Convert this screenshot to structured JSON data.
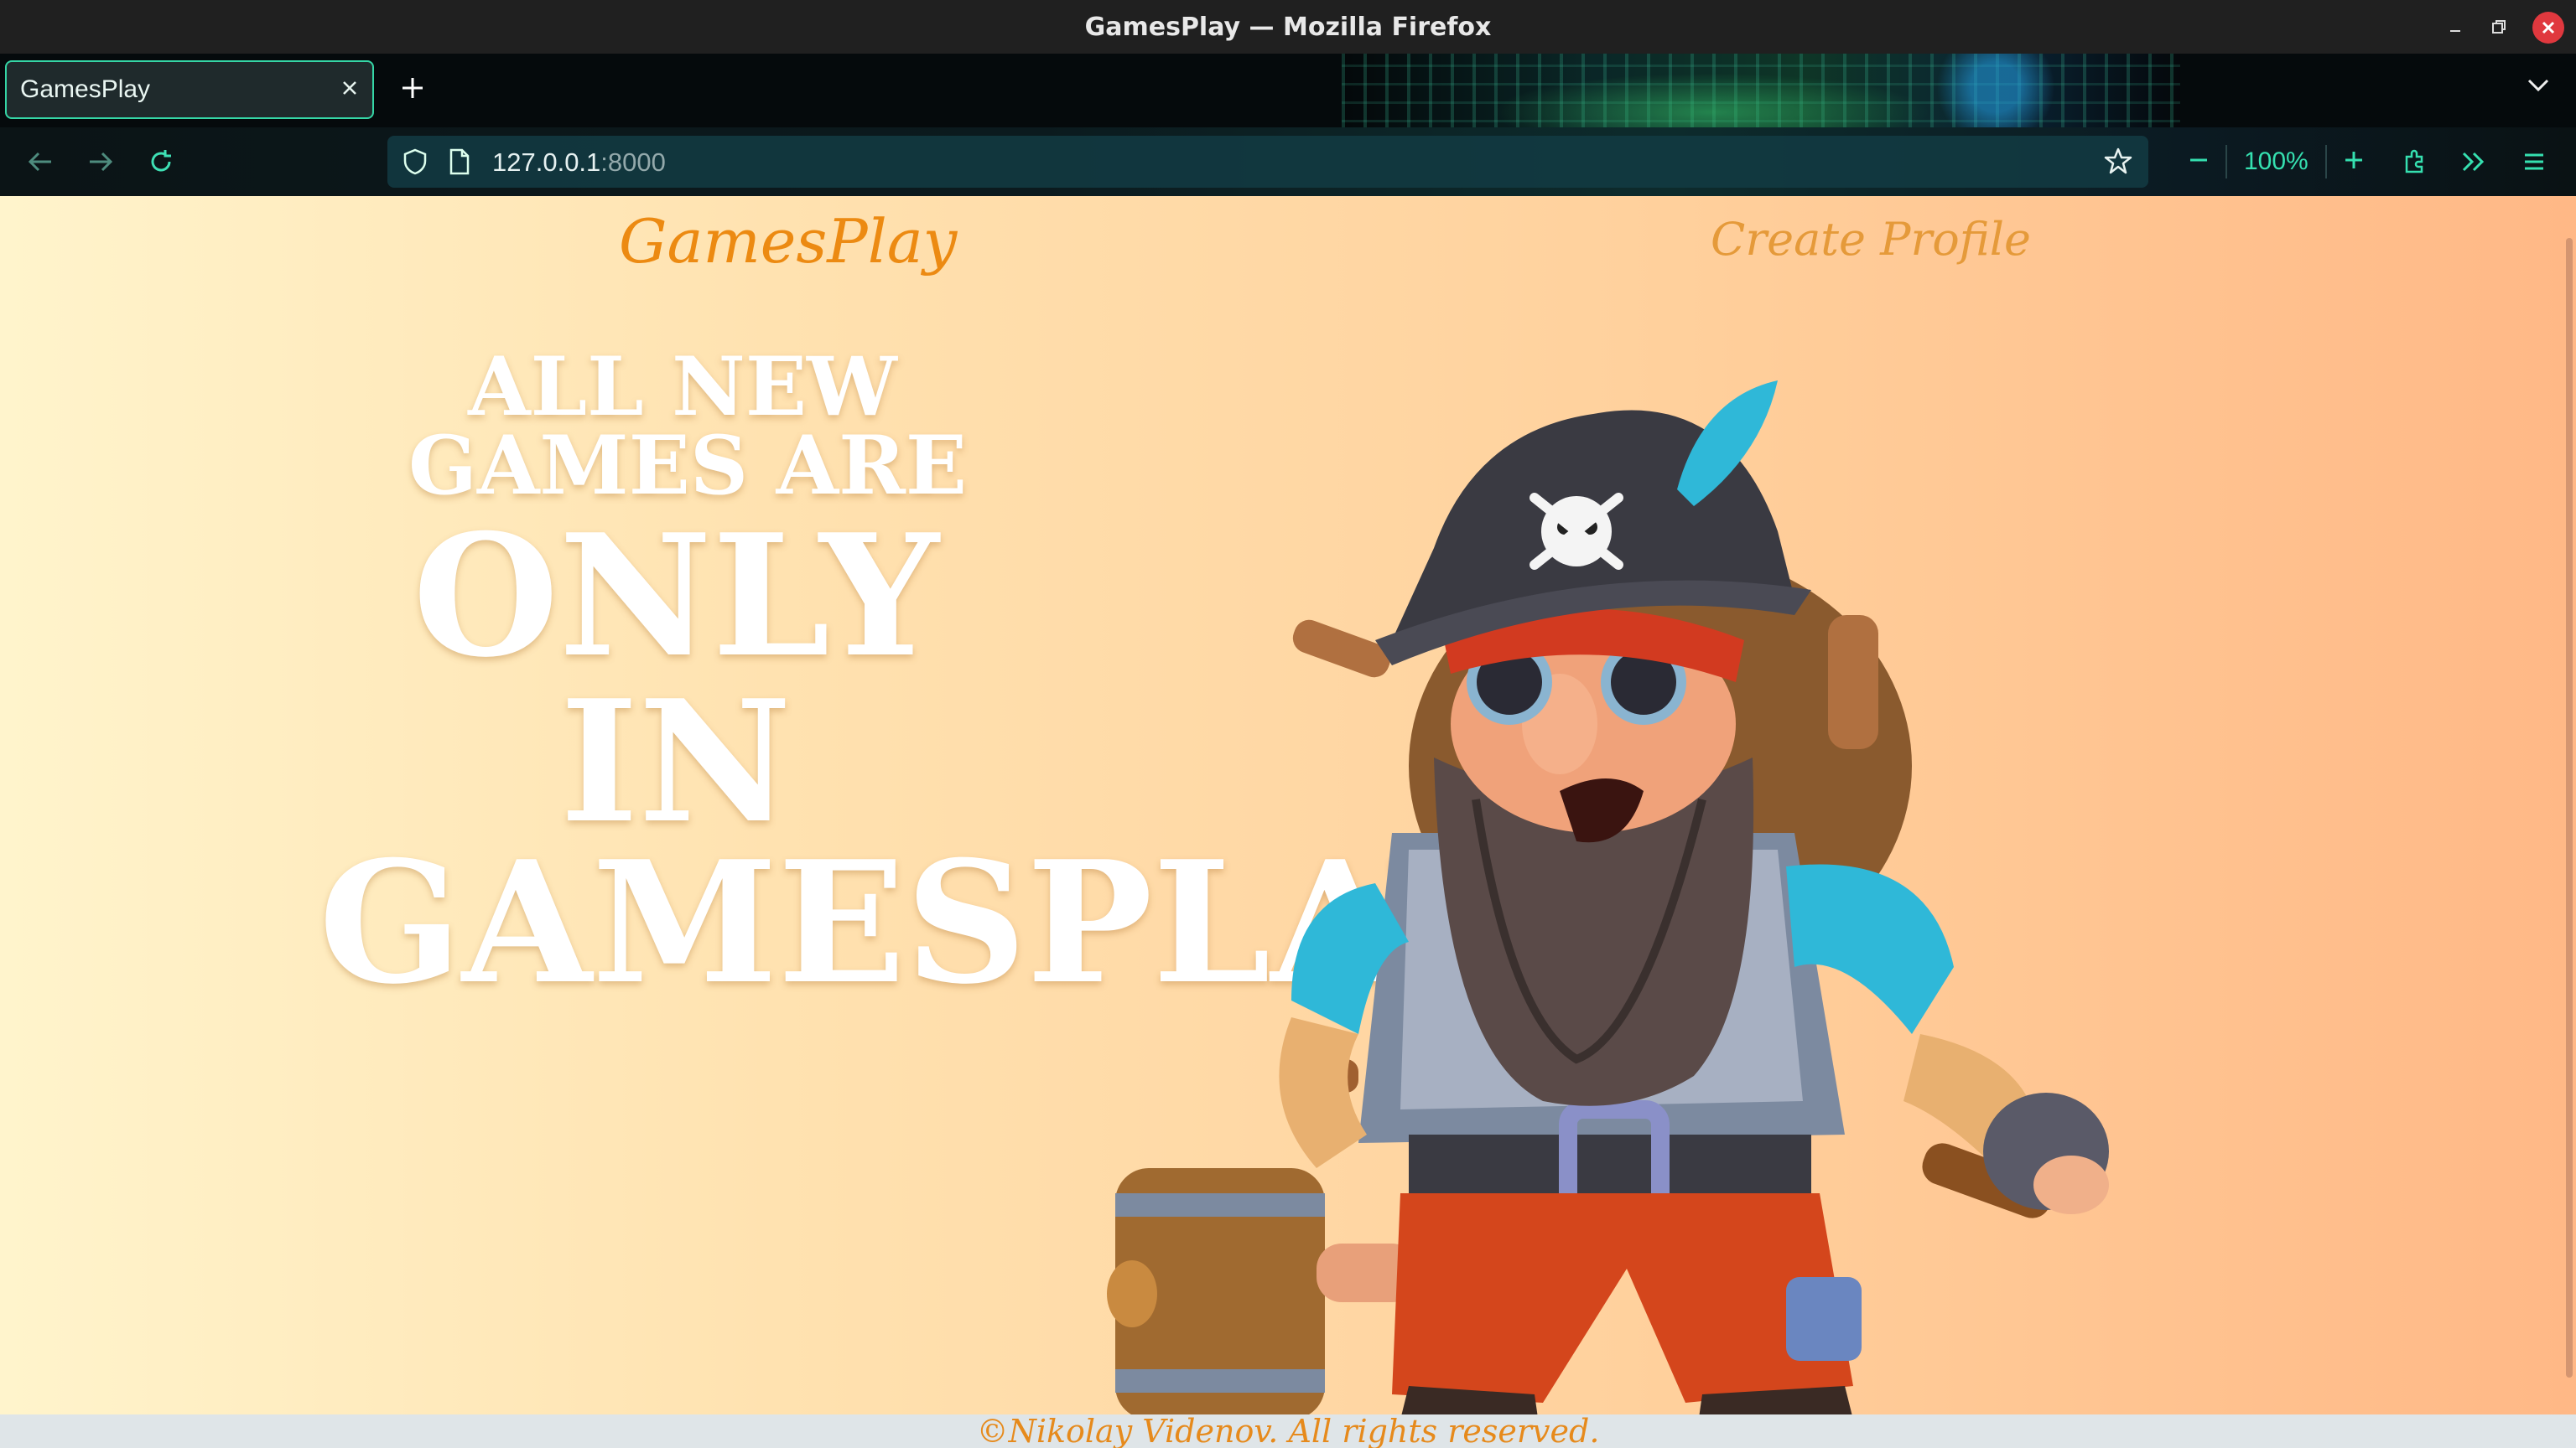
{
  "window": {
    "title": "GamesPlay — Mozilla Firefox"
  },
  "browser": {
    "tab": {
      "title": "GamesPlay"
    },
    "url": {
      "host": "127.0.0.1",
      "port": ":8000"
    },
    "zoom": "100%",
    "theme_colors": {
      "accent": "#35d6a6",
      "toolbar": "#0b1a1e"
    }
  },
  "page": {
    "header": {
      "logo": "GamesPlay",
      "nav_link": "Create Profile"
    },
    "hero": {
      "line1": "ALL NEW",
      "line2": "GAMES ARE",
      "line3": "ONLY",
      "line4": "IN",
      "line5": "GAMESPLAY"
    },
    "footer": {
      "text": "©Nikolay Videnov. All rights reserved."
    },
    "colors": {
      "brand": "#ec8a12",
      "background_start": "#fff4cc",
      "background_end": "#ffb886"
    }
  }
}
